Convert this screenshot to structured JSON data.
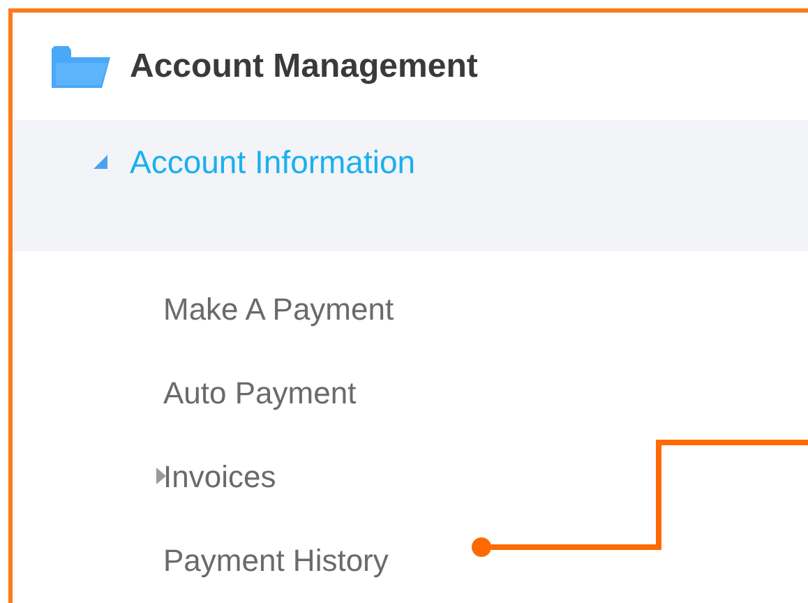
{
  "section": {
    "title": "Account Management"
  },
  "tree": [
    {
      "label": "Account Information",
      "selected": true,
      "expanded": true,
      "children": [
        {
          "label": "Make A Payment",
          "selected": false
        },
        {
          "label": "Auto Payment",
          "selected": false
        },
        {
          "label": "Invoices",
          "selected": false,
          "expanded": false
        },
        {
          "label": "Payment History",
          "selected": false
        }
      ]
    }
  ]
}
